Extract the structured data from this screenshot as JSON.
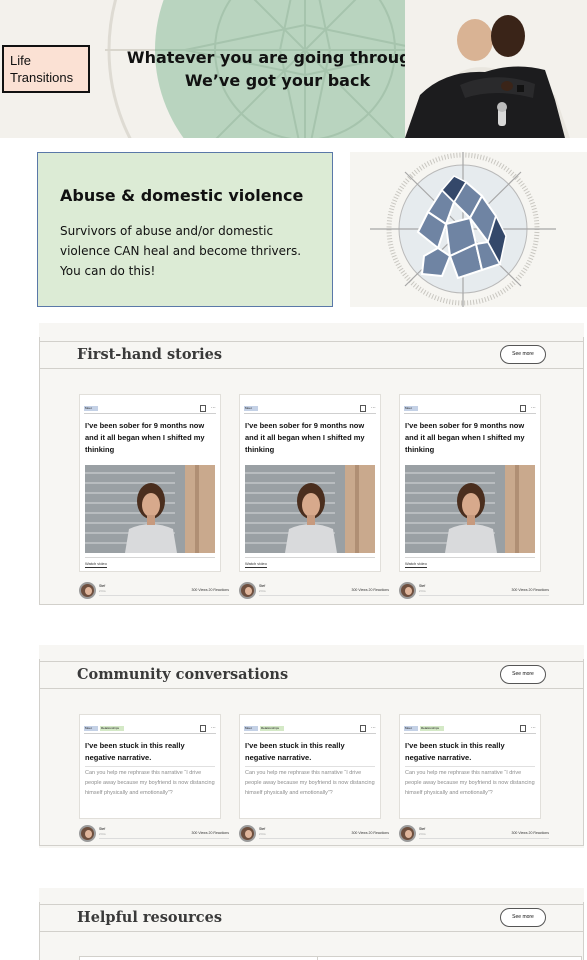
{
  "banner": {
    "badge_label": "Life Transitions",
    "tagline_line1": "Whatever you are going through,",
    "tagline_line2": "We’ve got your back"
  },
  "hero": {
    "title": "Abuse & domestic violence",
    "description": "Survivors of abuse and/or domestic violence CAN heal and become thrivers. You can do this!"
  },
  "sections": {
    "stories": {
      "title": "First-hand stories",
      "see_more": "See more",
      "cards": [
        {
          "tag": "Moet",
          "title": "I’ve been sober for 9 months now and it all began when I shifted my thinking",
          "link": "Watch video",
          "author": "Stef",
          "author_meta": "2 hrs",
          "stats": "300 Views  20 Reactions"
        },
        {
          "tag": "Moet",
          "title": "I’ve been sober for 9 months now and it all began when I shifted my thinking",
          "link": "Watch video",
          "author": "Stef",
          "author_meta": "2 hrs",
          "stats": "300 Views  20 Reactions"
        },
        {
          "tag": "Moet",
          "title": "I’ve been sober for 9 months now and it all began when I shifted my thinking",
          "link": "Watch video",
          "author": "Stef",
          "author_meta": "2 hrs",
          "stats": "300 Views  20 Reactions"
        }
      ]
    },
    "conversations": {
      "title": "Community conversations",
      "see_more": "See more",
      "cards": [
        {
          "tag": "Moet",
          "tag2": "Relationships",
          "title": "I’ve been stuck in this really negative narrative.",
          "excerpt": "Can you help me rephrase this narrative “I drive people away because my boyfriend is now distancing himself physically and emotionally”?",
          "author": "Stef",
          "author_meta": "2 hrs",
          "stats": "300 Views  20 Reactions"
        },
        {
          "tag": "Moet",
          "tag2": "Relationships",
          "title": "I’ve been stuck in this really negative narrative.",
          "excerpt": "Can you help me rephrase this narrative “I drive people away because my boyfriend is now distancing himself physically and emotionally”?",
          "author": "Stef",
          "author_meta": "2 hrs",
          "stats": "300 Views  20 Reactions"
        },
        {
          "tag": "Moet",
          "tag2": "Relationships",
          "title": "I’ve been stuck in this really negative narrative.",
          "excerpt": "Can you help me rephrase this narrative “I drive people away because my boyfriend is now distancing himself physically and emotionally”?",
          "author": "Stef",
          "author_meta": "2 hrs",
          "stats": "300 Views  20 Reactions"
        }
      ]
    },
    "resources": {
      "title": "Helpful resources",
      "see_more": "See more"
    }
  },
  "colors": {
    "hero_bg": "#dcebd5",
    "hero_border": "#5a78a8",
    "badge_bg": "#fbe1d4",
    "compass_green": "#b9d4bf",
    "tag_blue": "#c4d1e6",
    "tag_green": "#d4e9c6"
  },
  "icons": [
    "compass-emblem",
    "bookmark-icon",
    "more-icon",
    "avatar"
  ]
}
